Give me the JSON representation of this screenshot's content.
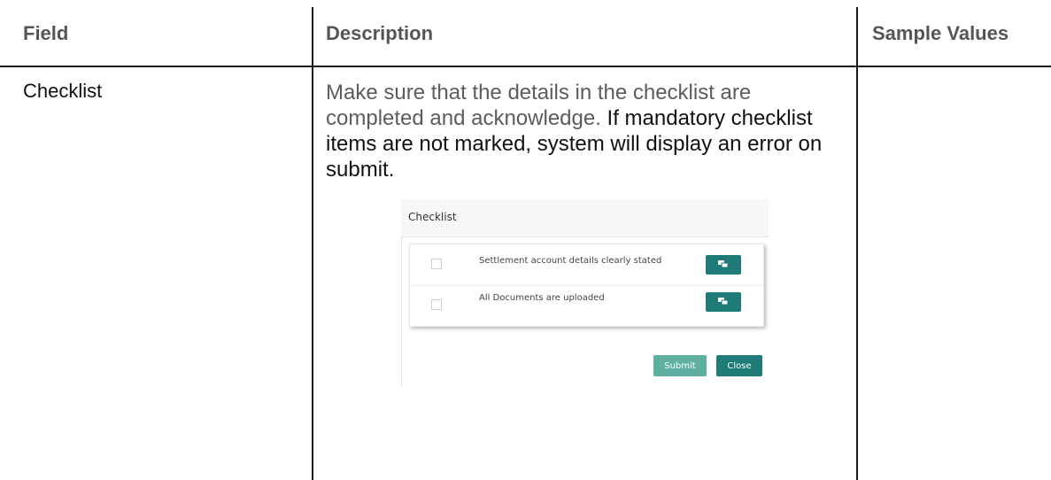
{
  "table": {
    "headers": [
      "Field",
      "Description",
      "Sample Values"
    ],
    "rows": [
      {
        "field": "Checklist",
        "description_part1": "Make sure that the details in the checklist are completed and acknowledge. ",
        "description_part2": "If mandatory checklist items are not marked, system will display an error on submit.",
        "sample": ""
      }
    ]
  },
  "checklist_dialog": {
    "title": "Checklist",
    "items": [
      {
        "label": "Settlement account details clearly stated",
        "checked": false,
        "icon": "comment-icon"
      },
      {
        "label": "All Documents are uploaded",
        "checked": false,
        "icon": "comment-icon"
      }
    ],
    "submit_label": "Submit",
    "close_label": "Close",
    "colors": {
      "primary": "#1f7b77",
      "primary_light": "#5fb0a3"
    }
  }
}
